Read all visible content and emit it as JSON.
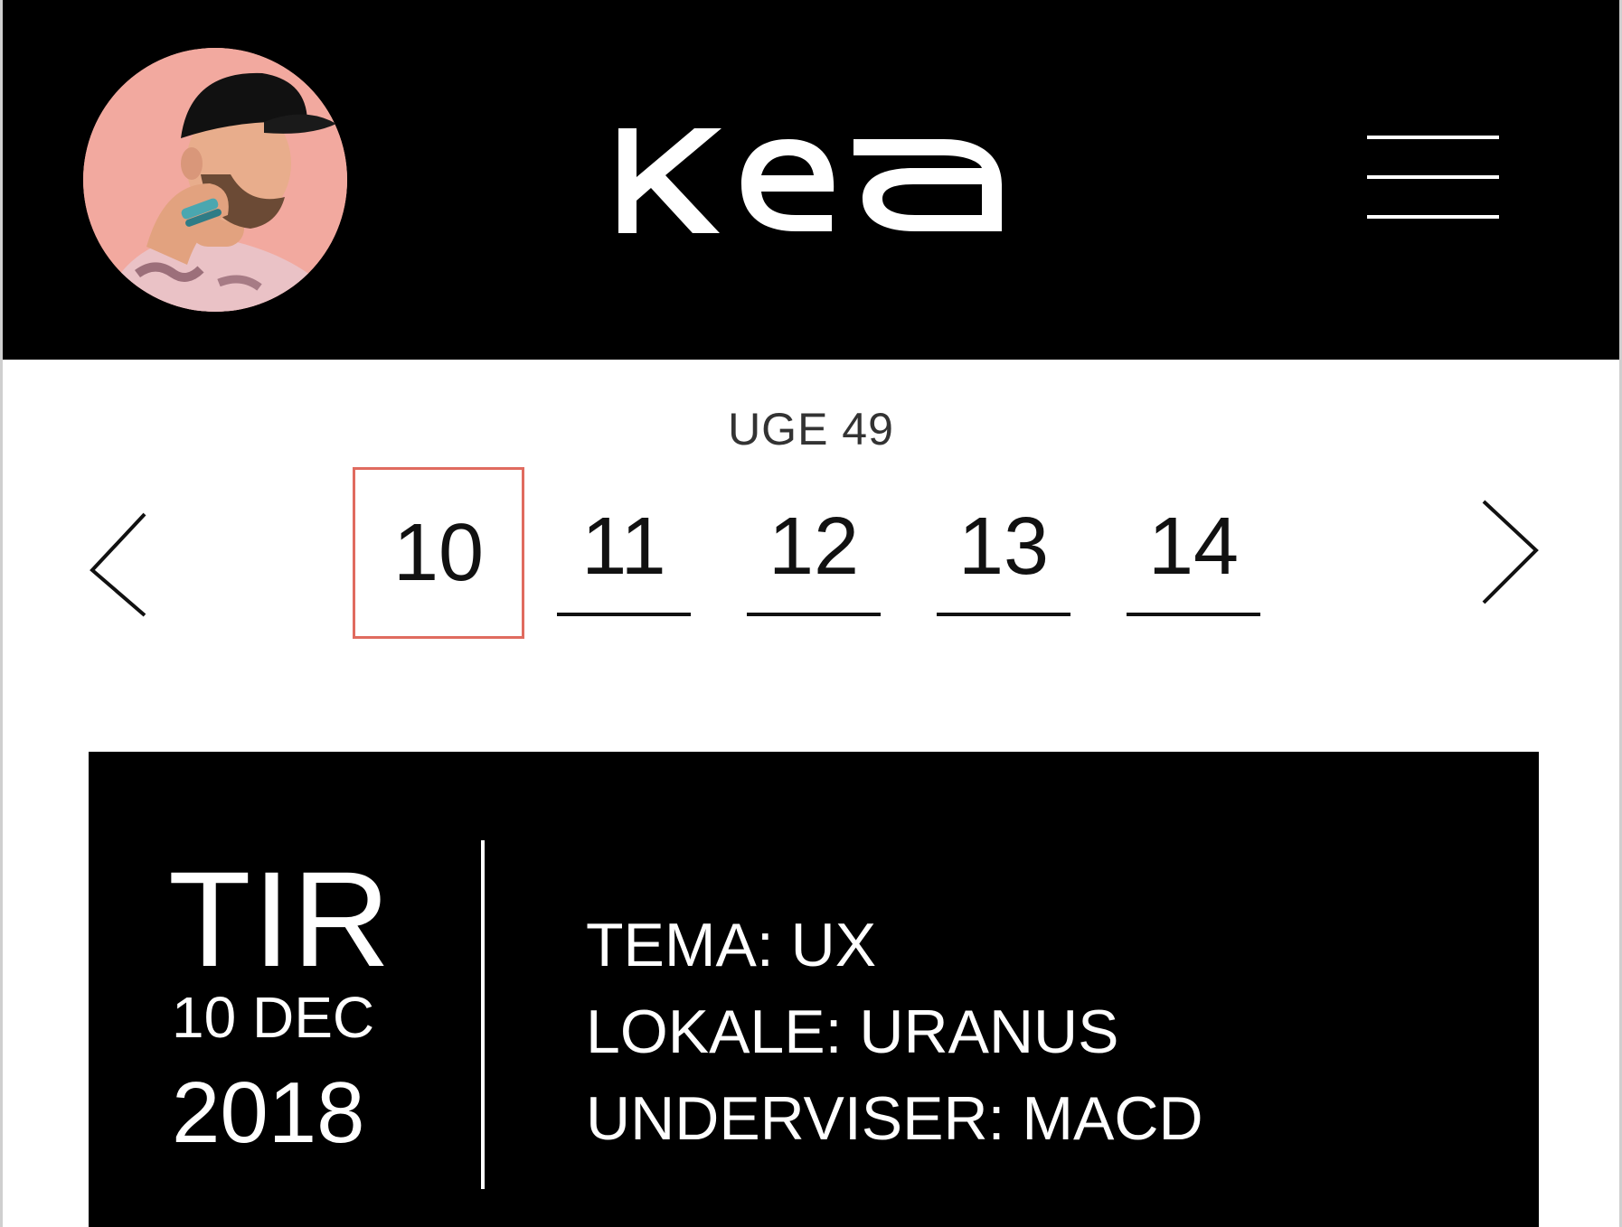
{
  "header": {
    "logo_text": "Kea",
    "avatar_alt": "profile-photo",
    "menu_icon": "hamburger-menu-icon"
  },
  "week": {
    "label": "UGE 49",
    "prev_icon": "chevron-left-icon",
    "next_icon": "chevron-right-icon",
    "days": [
      "10",
      "11",
      "12",
      "13",
      "14"
    ],
    "selected_day": "10"
  },
  "schedule_card": {
    "weekday": "TIR",
    "date": "10 DEC",
    "year": "2018",
    "theme": "TEMA: UX",
    "room": "LOKALE: URANUS",
    "teacher": "UNDERVISER: MACD"
  },
  "colors": {
    "header_bg": "#000000",
    "selected_border": "#e06b5f",
    "avatar_bg": "#f2a99f"
  }
}
